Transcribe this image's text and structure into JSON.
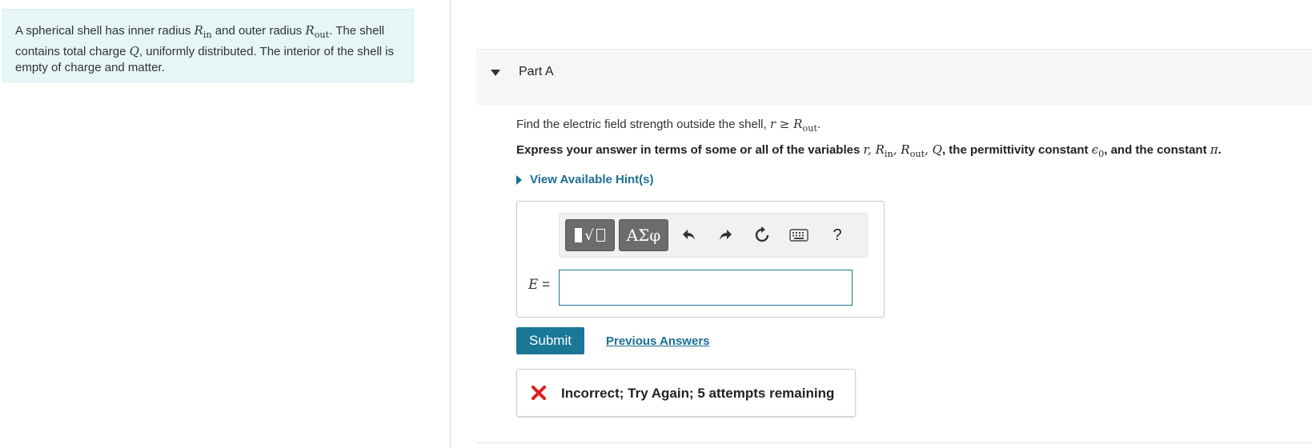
{
  "problem": {
    "t1": "A spherical shell has inner radius ",
    "R": "R",
    "in": "in",
    "t2": " and outer radius ",
    "out": "out",
    "t3": ". The shell contains total charge ",
    "Q": "Q",
    "t4": ", uniformly distributed. The interior of the shell is empty of charge and matter."
  },
  "part": {
    "title": "Part A"
  },
  "question": {
    "t1": "Find the electric field strength outside the shell, ",
    "cond": "r ≥ ",
    "R": "R",
    "out": "out",
    "t2": "."
  },
  "instruction": {
    "t1": "Express your answer in terms of some or all of the variables ",
    "vars1": "r",
    "c1": ", ",
    "R": "R",
    "in": "in",
    "out": "out",
    "Q": "Q",
    "t2": ", the permittivity constant ",
    "eps": "ϵ",
    "eps_sub": "0",
    "t3": ", and the constant ",
    "pi": "π",
    "t4": "."
  },
  "hint": {
    "label": "View Available Hint(s)"
  },
  "toolbar": {
    "symbols_label": "ΑΣφ",
    "help_label": "?"
  },
  "answer": {
    "variable": "E",
    "equals": " =",
    "value": ""
  },
  "submit_label": "Submit",
  "previous_answers_label": "Previous Answers",
  "feedback": {
    "text": "Incorrect; Try Again; 5 attempts remaining",
    "icon_color": "#e01e1e"
  },
  "colors": {
    "accent": "#1a7796",
    "problem_bg": "#e6f5f6",
    "link": "#1b6e92"
  },
  "icons": [
    "templates-icon",
    "undo-icon",
    "redo-icon",
    "reset-icon",
    "keyboard-icon",
    "help-icon",
    "error-x-icon"
  ]
}
